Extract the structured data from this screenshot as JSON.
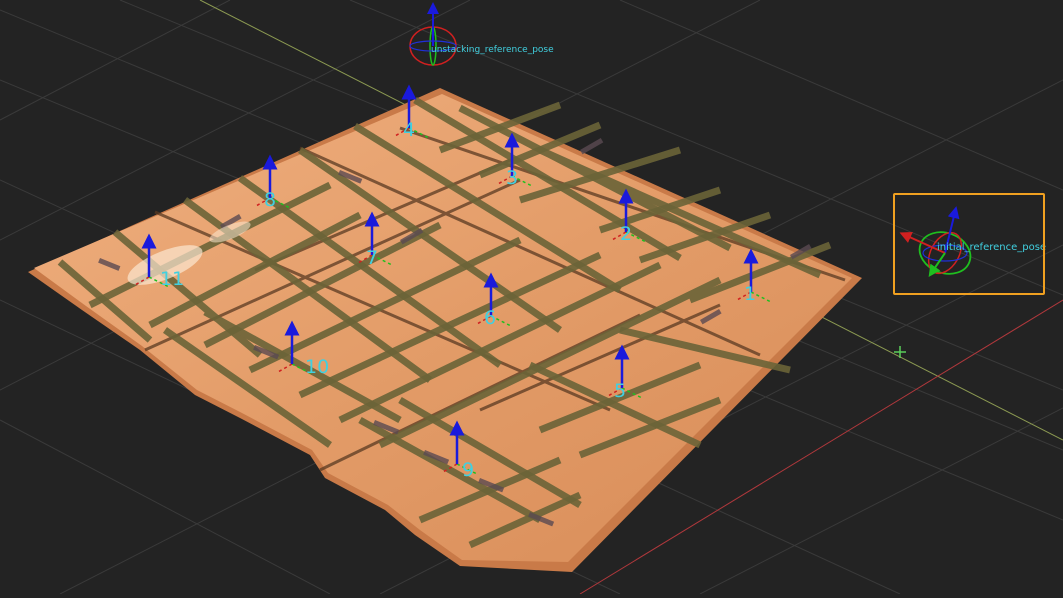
{
  "scene": {
    "background": "#232323",
    "grid_color": "#3a3a3a",
    "x_axis_color": "#8c9a52",
    "y_axis_color": "#b0383c",
    "pallet_color": "#e8a070",
    "strap_color": "#6b6438",
    "label_color": "#41d0e0"
  },
  "reference_poses": [
    {
      "name": "unstacking_reference_pose"
    },
    {
      "name": "initial_reference_pose",
      "selected": true
    }
  ],
  "boxes": [
    {
      "id": "1",
      "label": "1"
    },
    {
      "id": "2",
      "label": "2"
    },
    {
      "id": "3",
      "label": "3"
    },
    {
      "id": "4",
      "label": "4"
    },
    {
      "id": "5",
      "label": "5"
    },
    {
      "id": "6",
      "label": "6"
    },
    {
      "id": "7",
      "label": "7"
    },
    {
      "id": "8",
      "label": "8"
    },
    {
      "id": "9",
      "label": "9"
    },
    {
      "id": "10",
      "label": "10"
    },
    {
      "id": "11",
      "label": "11"
    }
  ]
}
